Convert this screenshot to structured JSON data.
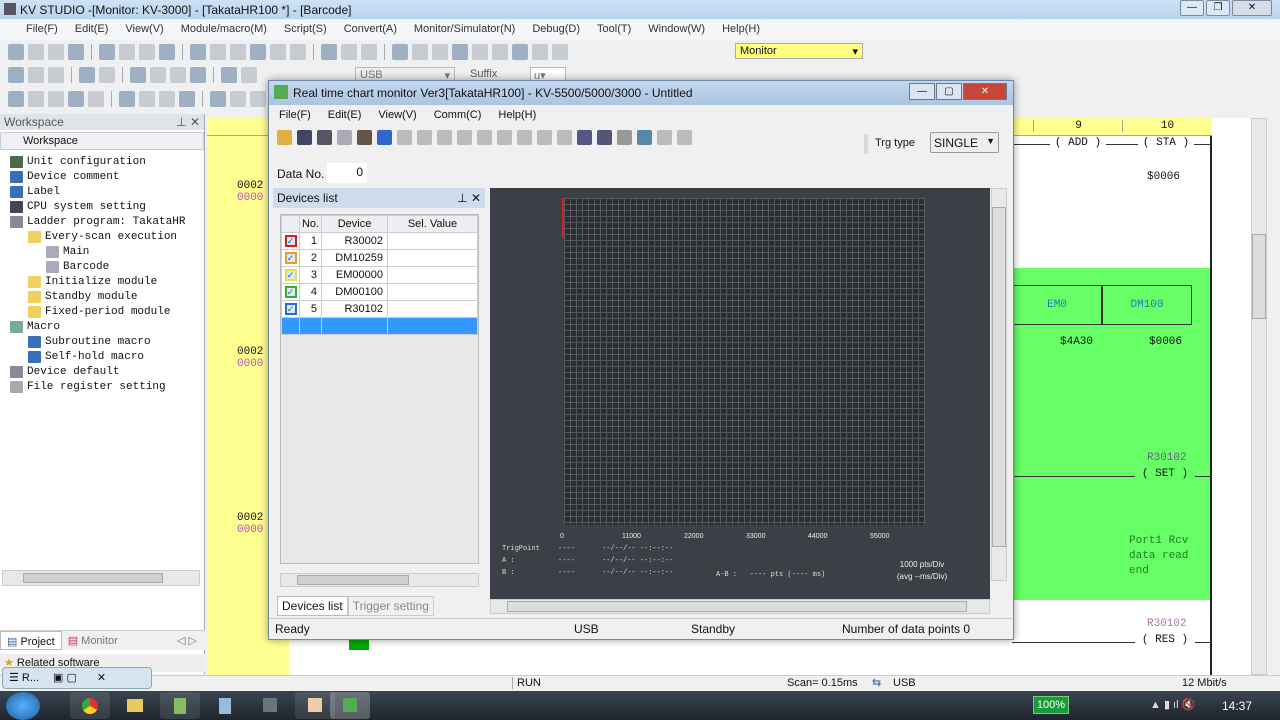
{
  "app": {
    "title": "KV STUDIO -[Monitor: KV-3000] - [TakataHR100 *] - [Barcode]",
    "menu": [
      "File(F)",
      "Edit(E)",
      "View(V)",
      "Module/macro(M)",
      "Script(S)",
      "Convert(A)",
      "Monitor/Simulator(N)",
      "Debug(D)",
      "Tool(T)",
      "Window(W)",
      "Help(H)"
    ],
    "mode_select": "Monitor",
    "conn_select": "USB",
    "suffix_label": "Suffix",
    "suffix_value": "u"
  },
  "workspace": {
    "title": "Workspace",
    "root": "Workspace",
    "tree": [
      {
        "label": "Unit configuration",
        "level": 0,
        "color": "#4a6a4a"
      },
      {
        "label": "Device comment",
        "level": 0,
        "color": "#3a6fb8"
      },
      {
        "label": "Label",
        "level": 0,
        "color": "#3a6fb8"
      },
      {
        "label": "CPU system setting",
        "level": 0,
        "color": "#445"
      },
      {
        "label": "Ladder program: TakataHR",
        "level": 0,
        "color": "#889"
      },
      {
        "label": "Every-scan execution",
        "level": 1,
        "color": "#f0d060"
      },
      {
        "label": "Main",
        "level": 2,
        "color": "#aab"
      },
      {
        "label": "Barcode",
        "level": 2,
        "color": "#aab"
      },
      {
        "label": "Initialize module",
        "level": 1,
        "color": "#f0d060"
      },
      {
        "label": "Standby module",
        "level": 1,
        "color": "#f0d060"
      },
      {
        "label": "Fixed-period module",
        "level": 1,
        "color": "#f0d060"
      },
      {
        "label": "Macro",
        "level": 0,
        "color": "#7a9"
      },
      {
        "label": "Subroutine macro",
        "level": 1,
        "color": "#3a6fb8"
      },
      {
        "label": "Self-hold macro",
        "level": 1,
        "color": "#3a6fb8"
      },
      {
        "label": "Device default",
        "level": 0,
        "color": "#889"
      },
      {
        "label": "File register setting",
        "level": 0,
        "color": "#aaa"
      }
    ],
    "tabs": [
      "Project",
      "Monitor"
    ],
    "related": "Related software"
  },
  "ladder": {
    "columns": [
      "9",
      "10"
    ],
    "row_labels": [
      {
        "a": "0002",
        "b": "0000"
      },
      {
        "a": "0002",
        "b": "0000"
      },
      {
        "a": "0002",
        "b": "0000"
      }
    ],
    "add": "ADD",
    "sta": "STA",
    "sta_val": "$0006",
    "em0": "EM0",
    "dm100": "DM100",
    "em0_val": "$4A30",
    "dm100_val": "$0006",
    "set_dev": "R30102",
    "set": "SET",
    "comment": "Port1 Rcv data read end",
    "res_dev": "R30102",
    "res": "RES"
  },
  "rtchart": {
    "title": "Real time chart monitor Ver3[TakataHR100] - KV-5500/5000/3000 - Untitled",
    "menu": [
      "File(F)",
      "Edit(E)",
      "View(V)",
      "Comm(C)",
      "Help(H)"
    ],
    "trg_type_label": "Trg type",
    "trg_type": "SINGLE",
    "data_no_label": "Data No.",
    "data_no": "0",
    "devices_title": "Devices list",
    "headers": [
      "No.",
      "Device",
      "Sel. Value"
    ],
    "devices": [
      {
        "no": "1",
        "device": "R30002",
        "value": "",
        "color": "#d02020",
        "checked": true
      },
      {
        "no": "2",
        "device": "DM10259",
        "value": "",
        "color": "#e0a030",
        "checked": true
      },
      {
        "no": "3",
        "device": "EM00000",
        "value": "",
        "color": "#e8e040",
        "checked": true
      },
      {
        "no": "4",
        "device": "DM00100",
        "value": "",
        "color": "#30b030",
        "checked": true
      },
      {
        "no": "5",
        "device": "R30102",
        "value": "",
        "color": "#2a70c0",
        "checked": true
      }
    ],
    "tabs": [
      "Devices list",
      "Trigger setting"
    ],
    "x_ticks": [
      "0",
      "11000",
      "22000",
      "33000",
      "44000",
      "55000"
    ],
    "trig_rows": [
      {
        "label": "TrigPoint",
        "pts": "----",
        "time": "--/--/-- --:--:--"
      },
      {
        "label": "A :",
        "pts": "----",
        "time": "--/--/-- --:--:--"
      },
      {
        "label": "B :",
        "pts": "----",
        "time": "--/--/-- --:--:--"
      }
    ],
    "ab": "A-B :   ---- pts (---- ms)",
    "pts_div": "1000 pts/Div",
    "avg_div": "(avg --ms/Div)",
    "status": {
      "ready": "Ready",
      "conn": "USB",
      "state": "Standby",
      "points": "Number of data points 0"
    },
    "trace_color": "#d02020"
  },
  "statusbar": {
    "run": "RUN",
    "scan": "Scan=  0.15ms",
    "conn": "USB",
    "speed": "12 Mbit/s"
  },
  "floating": {
    "label": "R..."
  },
  "taskbar": {
    "battery": "100%",
    "clock": "14:37"
  }
}
